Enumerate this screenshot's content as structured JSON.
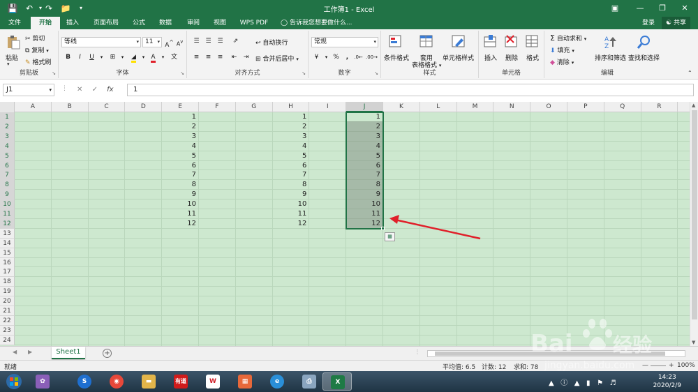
{
  "window": {
    "title": "工作簿1 - Excel"
  },
  "tabs": [
    "文件",
    "开始",
    "插入",
    "页面布局",
    "公式",
    "数据",
    "审阅",
    "视图",
    "WPS PDF"
  ],
  "active_tab": "开始",
  "tell_me": "告诉我您想要做什么...",
  "account": {
    "login": "登录",
    "share": "共享"
  },
  "ribbon": {
    "clipboard": {
      "paste": "粘贴",
      "cut": "剪切",
      "copy": "复制",
      "format_painter": "格式刷",
      "label": "剪贴板"
    },
    "font": {
      "name": "等线",
      "size": "11",
      "bold": "B",
      "italic": "I",
      "underline": "U",
      "grow": "A",
      "shrink": "A",
      "label": "字体"
    },
    "alignment": {
      "wrap": "自动换行",
      "merge": "合并后居中",
      "label": "对齐方式"
    },
    "number": {
      "format": "常规",
      "percent": "%",
      "comma": ",",
      "label": "数字"
    },
    "styles": {
      "conditional": "条件格式",
      "table_line1": "套用",
      "table_line2": "表格格式",
      "cell_styles": "单元格样式",
      "label": "样式"
    },
    "cells": {
      "insert": "插入",
      "delete": "删除",
      "format": "格式",
      "label": "单元格"
    },
    "editing": {
      "autosum": "自动求和",
      "fill": "填充",
      "clear": "清除",
      "sort": "排序和筛选",
      "find": "查找和选择",
      "label": "编辑"
    }
  },
  "formula_bar": {
    "name_box": "J1",
    "fx": "fx",
    "value": "1"
  },
  "columns": [
    "A",
    "B",
    "C",
    "D",
    "E",
    "F",
    "G",
    "H",
    "I",
    "J",
    "K",
    "L",
    "M",
    "N",
    "O",
    "P",
    "Q",
    "R"
  ],
  "selected_column": "J",
  "rows": [
    "1",
    "2",
    "3",
    "4",
    "5",
    "6",
    "7",
    "8",
    "9",
    "10",
    "11",
    "12",
    "13",
    "14",
    "15",
    "16",
    "17",
    "18",
    "19",
    "20",
    "21",
    "22",
    "23",
    "24"
  ],
  "col_E": [
    "1",
    "2",
    "3",
    "4",
    "5",
    "6",
    "7",
    "8",
    "9",
    "10",
    "11",
    "12"
  ],
  "col_H": [
    "1",
    "2",
    "3",
    "4",
    "5",
    "6",
    "7",
    "8",
    "9",
    "10",
    "11",
    "12"
  ],
  "col_J": [
    "1",
    "2",
    "3",
    "4",
    "5",
    "6",
    "7",
    "8",
    "9",
    "10",
    "11",
    "12"
  ],
  "sheet": {
    "name": "Sheet1",
    "add": "+"
  },
  "status": {
    "ready": "就绪",
    "average": "平均值: 6.5",
    "count": "计数: 12",
    "sum": "求和: 78",
    "zoom": "100%"
  },
  "taskbar": {
    "time": "14:23",
    "date": "2020/2/9",
    "youdao": "有道"
  },
  "colors": {
    "accent": "#217346",
    "grid_bg": "#cde8cf",
    "arrow": "#e0202a"
  }
}
